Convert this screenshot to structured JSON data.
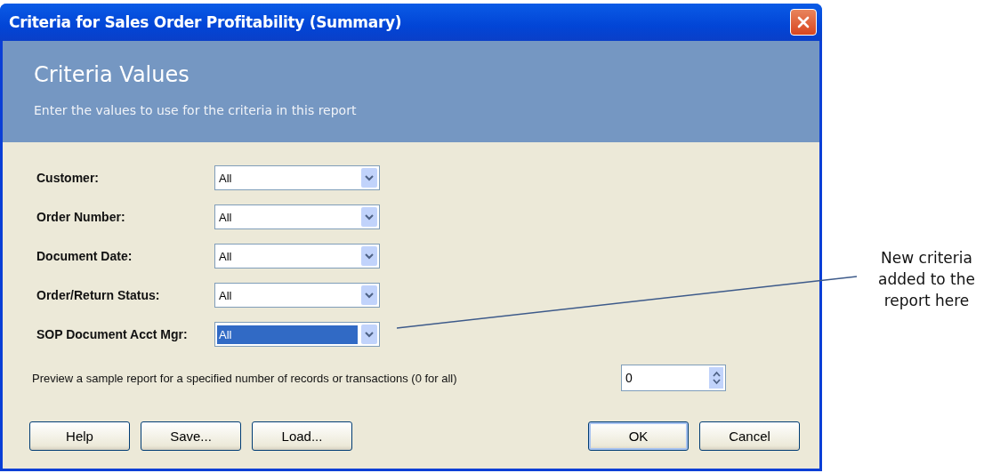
{
  "window": {
    "title": "Criteria for Sales Order Profitability (Summary)"
  },
  "header": {
    "heading": "Criteria Values",
    "subtitle": "Enter the values to use for the criteria in this report"
  },
  "criteria": [
    {
      "label": "Customer:",
      "value": "All",
      "selected": false
    },
    {
      "label": "Order Number:",
      "value": "All",
      "selected": false
    },
    {
      "label": "Document Date:",
      "value": "All",
      "selected": false
    },
    {
      "label": "Order/Return Status:",
      "value": "All",
      "selected": false
    },
    {
      "label": "SOP Document Acct Mgr:",
      "value": "All",
      "selected": true
    }
  ],
  "preview": {
    "label": "Preview a sample report for a specified number of records or transactions (0 for all)",
    "value": "0"
  },
  "buttons_left": [
    "Help",
    "Save...",
    "Load..."
  ],
  "buttons_right": [
    "OK",
    "Cancel"
  ],
  "annotation": {
    "text": "New criteria added to the report here"
  }
}
